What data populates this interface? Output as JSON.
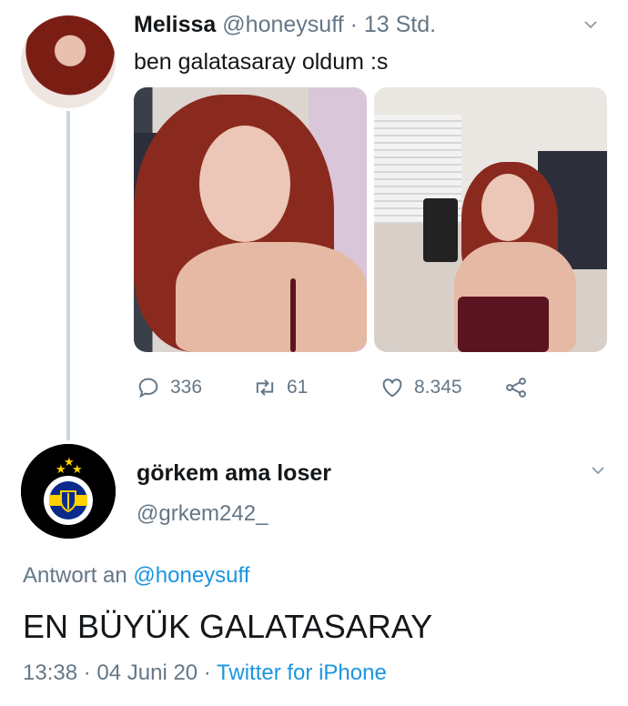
{
  "tweet": {
    "display_name": "Melissa",
    "handle": "@honeysuff",
    "separator": " · ",
    "time": "13 Std.",
    "text": "ben galatasaray oldum :s",
    "replies": "336",
    "retweets": "61",
    "likes": "8.345"
  },
  "reply": {
    "display_name": "görkem ama loser",
    "handle": "@grkem242_",
    "reply_prefix": "Antwort an ",
    "reply_to": "@honeysuff",
    "text": "EN BÜYÜK GALATASARAY",
    "timestamp": "13:38 · 04 Juni 20 · ",
    "source": "Twitter for iPhone"
  },
  "colors": {
    "secondary": "#657786",
    "link": "#1b95e0",
    "thread_line": "#ccd6dd"
  },
  "icons": [
    "reply-icon",
    "retweet-icon",
    "like-icon",
    "share-icon",
    "chevron-down-icon",
    "fenerbahce-logo-icon"
  ]
}
